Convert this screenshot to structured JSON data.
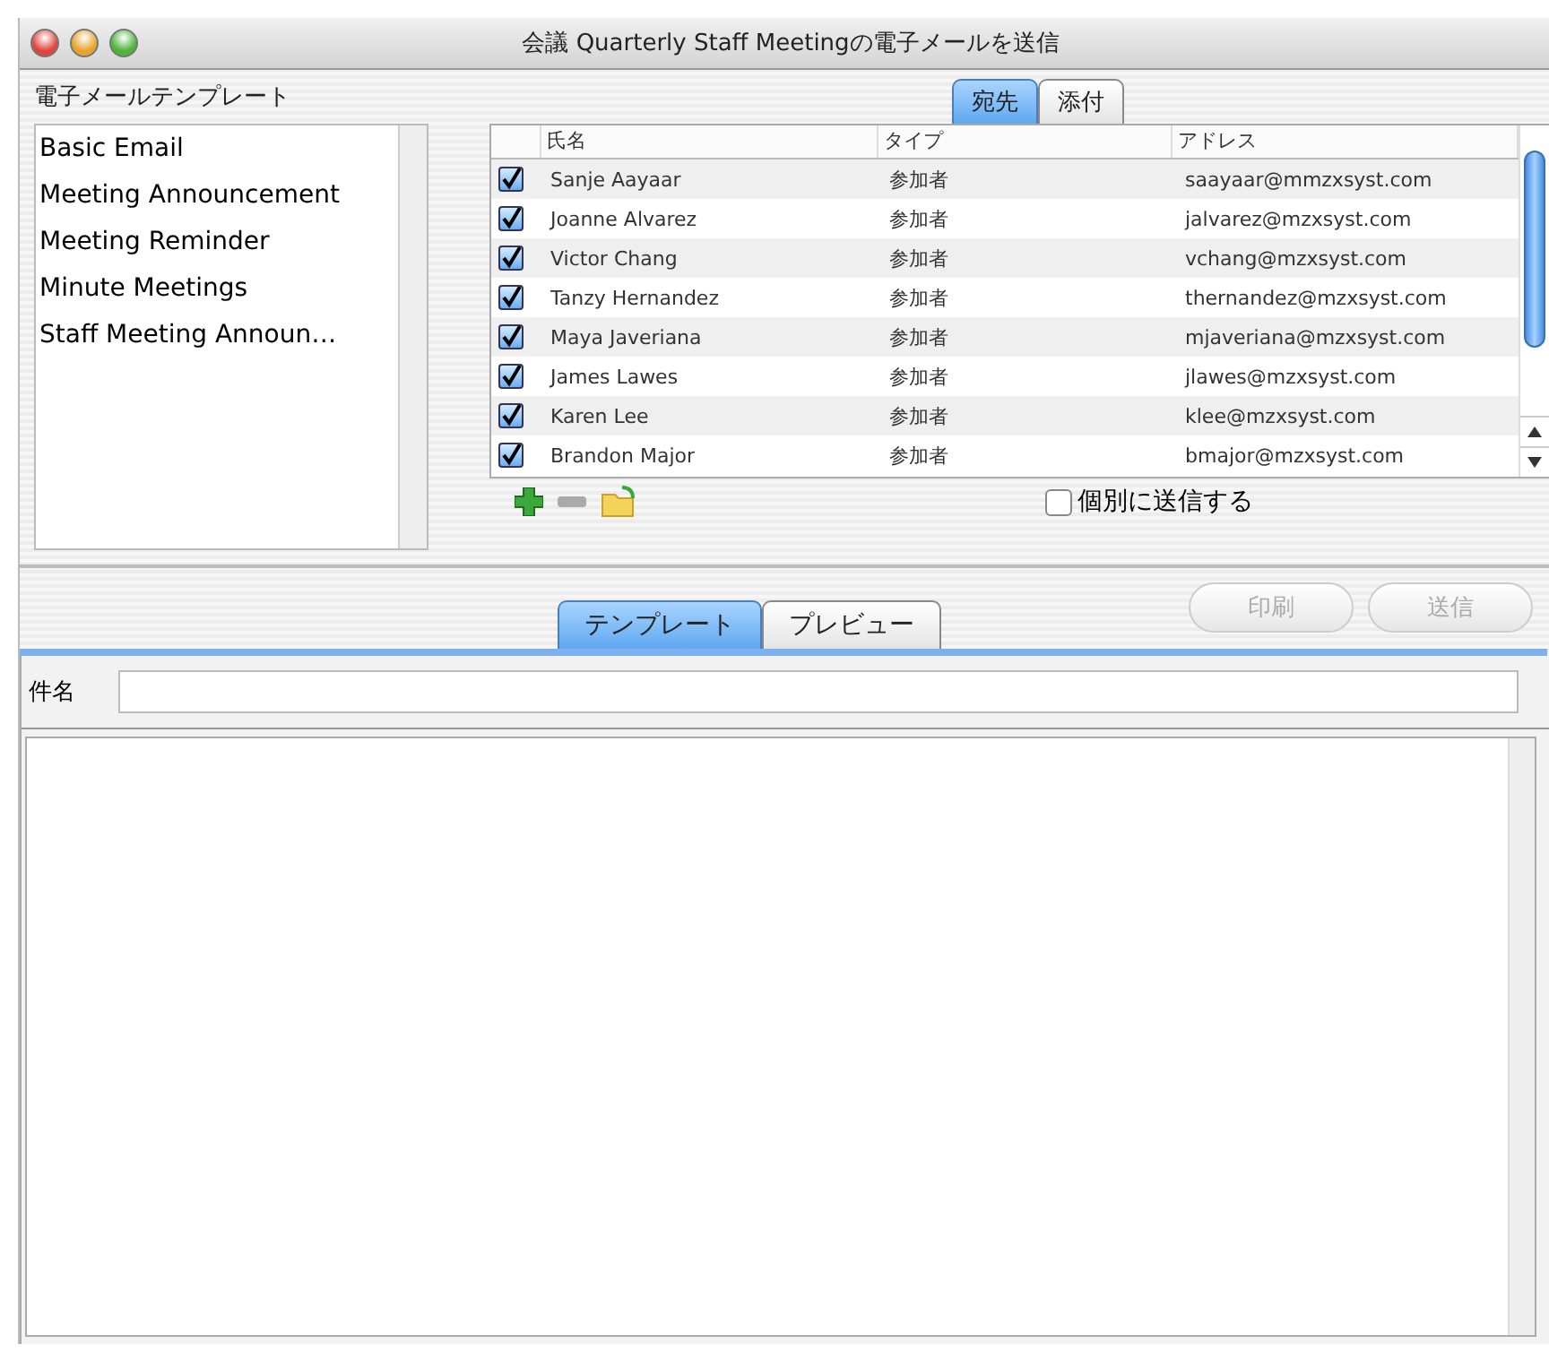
{
  "window": {
    "title": "会議 Quarterly Staff Meetingの電子メールを送信"
  },
  "templates": {
    "label": "電子メールテンプレート",
    "items": [
      {
        "label": "Basic Email"
      },
      {
        "label": "Meeting Announcement"
      },
      {
        "label": "Meeting Reminder"
      },
      {
        "label": "Minute Meetings"
      },
      {
        "label": "Staff Meeting Announ…"
      }
    ]
  },
  "recipient_tabs": [
    {
      "label": "宛先",
      "selected": true
    },
    {
      "label": "添付",
      "selected": false
    }
  ],
  "recipients": {
    "columns": [
      "氏名",
      "タイプ",
      "アドレス"
    ],
    "rows": [
      {
        "checked": true,
        "name": "Sanje Aayaar",
        "type": "参加者",
        "address": "saayaar@mmzxsyst.com"
      },
      {
        "checked": true,
        "name": "Joanne Alvarez",
        "type": "参加者",
        "address": "jalvarez@mzxsyst.com"
      },
      {
        "checked": true,
        "name": "Victor Chang",
        "type": "参加者",
        "address": "vchang@mzxsyst.com"
      },
      {
        "checked": true,
        "name": "Tanzy Hernandez",
        "type": "参加者",
        "address": "thernandez@mzxsyst.com"
      },
      {
        "checked": true,
        "name": "Maya Javeriana",
        "type": "参加者",
        "address": "mjaveriana@mzxsyst.com"
      },
      {
        "checked": true,
        "name": "James Lawes",
        "type": "参加者",
        "address": "jlawes@mzxsyst.com"
      },
      {
        "checked": true,
        "name": "Karen Lee",
        "type": "参加者",
        "address": "klee@mzxsyst.com"
      },
      {
        "checked": true,
        "name": "Brandon Major",
        "type": "参加者",
        "address": "bmajor@mzxsyst.com"
      }
    ]
  },
  "send_individually": {
    "label": "個別に送信する",
    "checked": false
  },
  "editor_tabs": [
    {
      "label": "テンプレート",
      "selected": true
    },
    {
      "label": "プレビュー",
      "selected": false
    }
  ],
  "buttons": [
    {
      "label": "印刷",
      "disabled": true
    },
    {
      "label": "送信",
      "disabled": true
    }
  ],
  "subject": {
    "label": "件名"
  }
}
